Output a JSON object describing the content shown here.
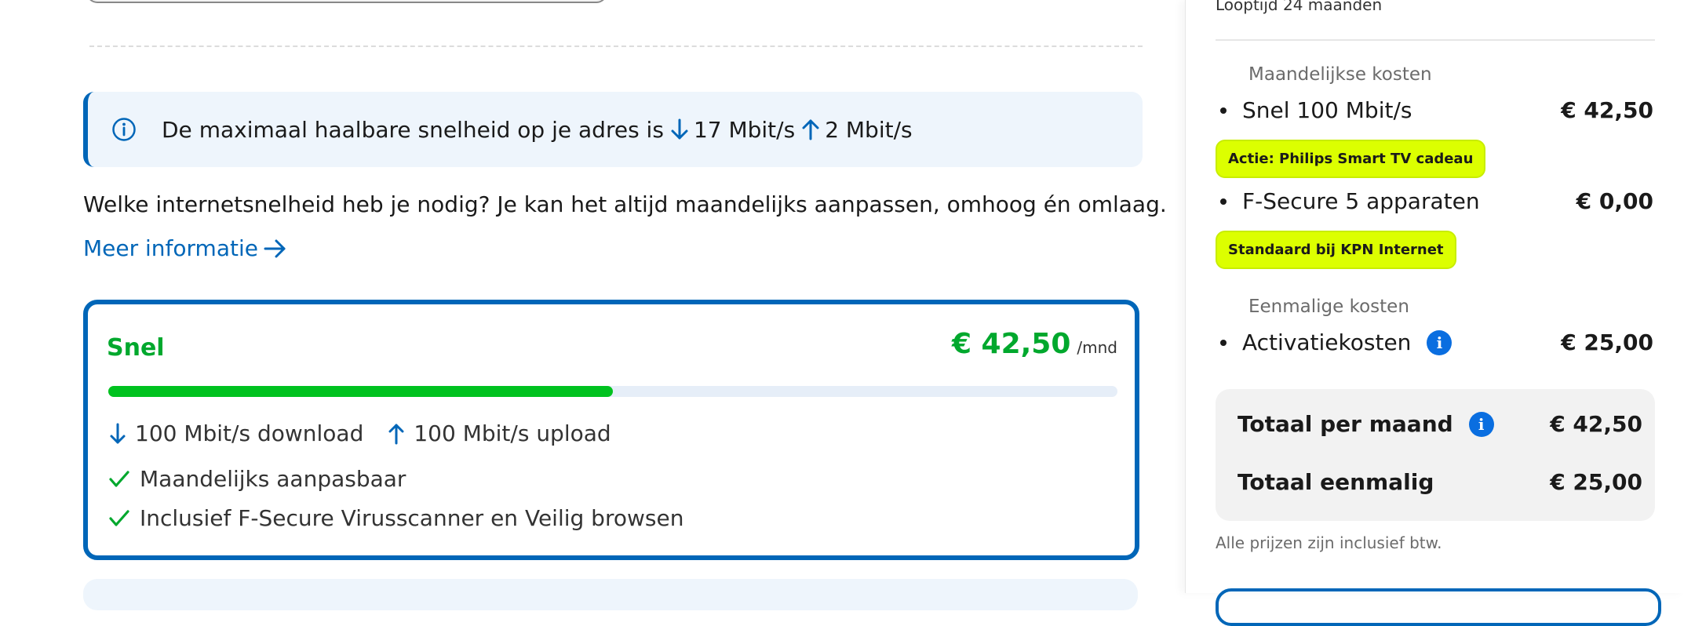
{
  "info": {
    "text": "De maximaal haalbare snelheid op je adres is",
    "download": "17 Mbit/s",
    "upload": "2 Mbit/s"
  },
  "question": "Welke internetsnelheid heb je nodig? Je kan het altijd maandelijks aanpassen, omhoog én omlaag.",
  "more_link": "Meer informatie",
  "card": {
    "title": "Snel",
    "price": "€ 42,50",
    "per": "/mnd",
    "speed_fraction": 0.5,
    "download": "100 Mbit/s download",
    "upload": "100 Mbit/s upload",
    "features": [
      "Maandelijks aanpasbaar",
      "Inclusief F-Secure Virusscanner en Veilig browsen"
    ]
  },
  "colors": {
    "brand_blue": "#0066b8",
    "green": "#00a82d",
    "promo": "#dcff00"
  },
  "summary": {
    "looptijd": "Looptijd 24 maanden",
    "monthly_header": "Maandelijkse kosten",
    "items": [
      {
        "label": "Snel 100 Mbit/s",
        "value": "€ 42,50",
        "badge": "Actie: Philips Smart TV cadeau"
      },
      {
        "label": "F-Secure 5 apparaten",
        "value": "€ 0,00",
        "badge": "Standaard bij KPN Internet"
      }
    ],
    "onetime_header": "Eenmalige kosten",
    "onetime_items": [
      {
        "label": "Activatiekosten",
        "value": "€ 25,00"
      }
    ],
    "total_month_label": "Totaal per maand",
    "total_month_value": "€ 42,50",
    "total_once_label": "Totaal eenmalig",
    "total_once_value": "€ 25,00",
    "note": "Alle prijzen zijn inclusief btw."
  }
}
